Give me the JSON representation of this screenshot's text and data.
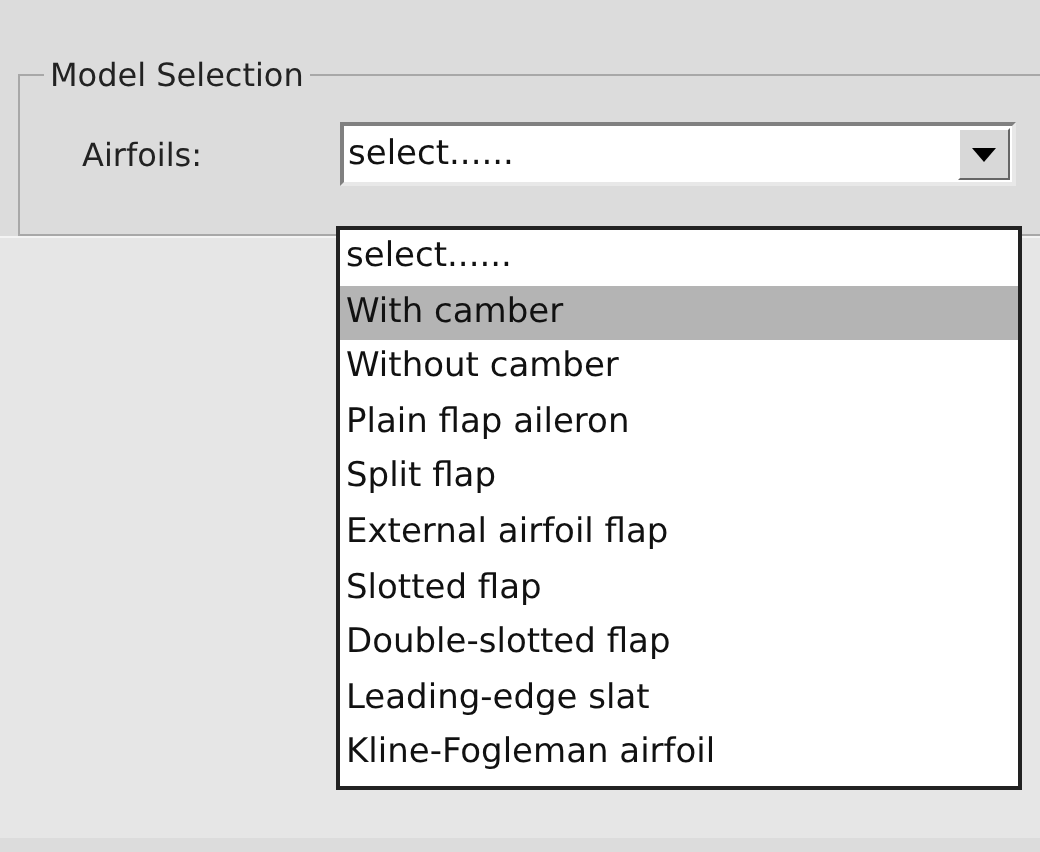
{
  "group": {
    "title": "Model Selection"
  },
  "field": {
    "label": "Airfoils:",
    "value": "select......",
    "expanded": true
  },
  "options": [
    {
      "label": "select......",
      "selected": false
    },
    {
      "label": "With camber",
      "selected": true
    },
    {
      "label": "Without camber",
      "selected": false
    },
    {
      "label": "Plain flap aileron",
      "selected": false
    },
    {
      "label": "Split flap",
      "selected": false
    },
    {
      "label": "External airfoil flap",
      "selected": false
    },
    {
      "label": "Slotted flap",
      "selected": false
    },
    {
      "label": "Double-slotted flap",
      "selected": false
    },
    {
      "label": "Leading-edge slat",
      "selected": false
    },
    {
      "label": "Kline-Fogleman airfoil",
      "selected": false
    }
  ]
}
